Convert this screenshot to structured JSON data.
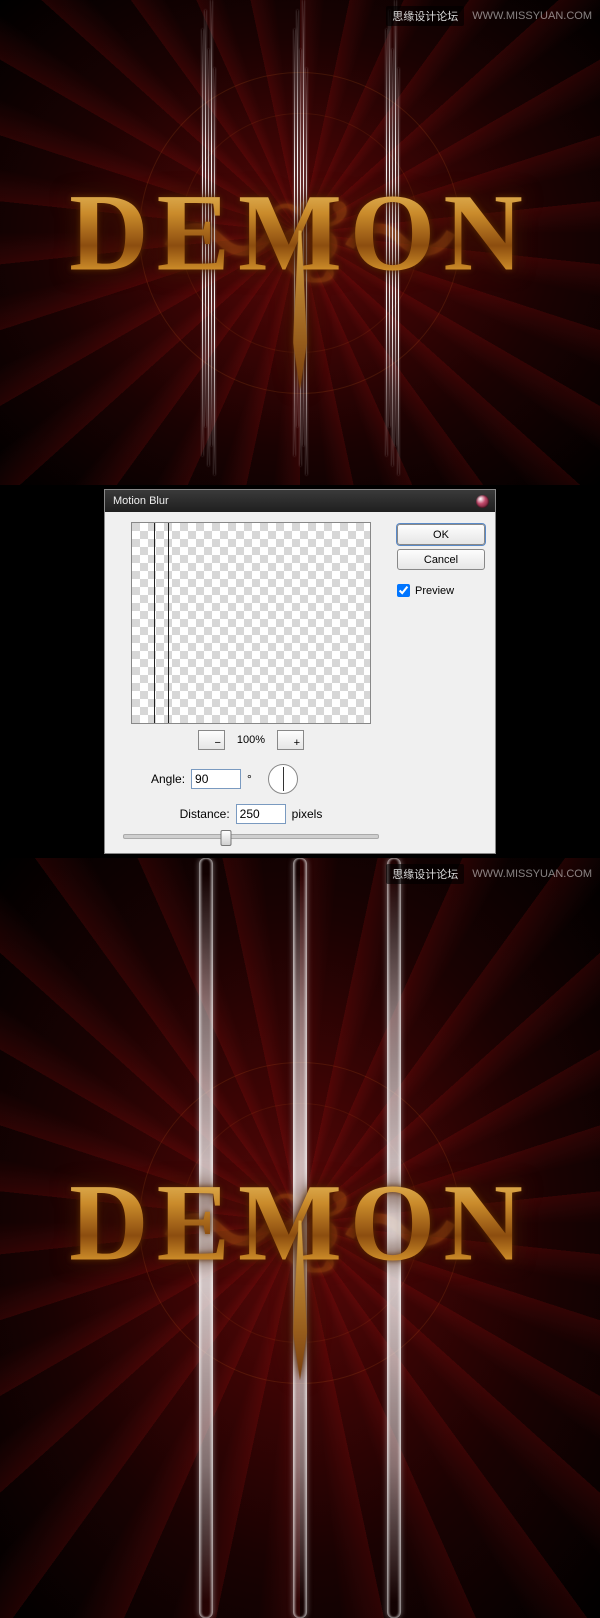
{
  "watermark": {
    "logo_text": "思缘设计论坛",
    "url_text": "WWW.MISSYUAN.COM"
  },
  "artwork": {
    "title_text": "DEMON"
  },
  "dialog": {
    "title": "Motion Blur",
    "buttons": {
      "ok": "OK",
      "cancel": "Cancel"
    },
    "preview_checkbox": "Preview",
    "zoom": {
      "minus": "−",
      "percent": "100%",
      "plus": "+"
    },
    "angle": {
      "label": "Angle:",
      "value": "90",
      "unit": "°"
    },
    "distance": {
      "label": "Distance:",
      "value": "250",
      "unit": "pixels"
    }
  }
}
